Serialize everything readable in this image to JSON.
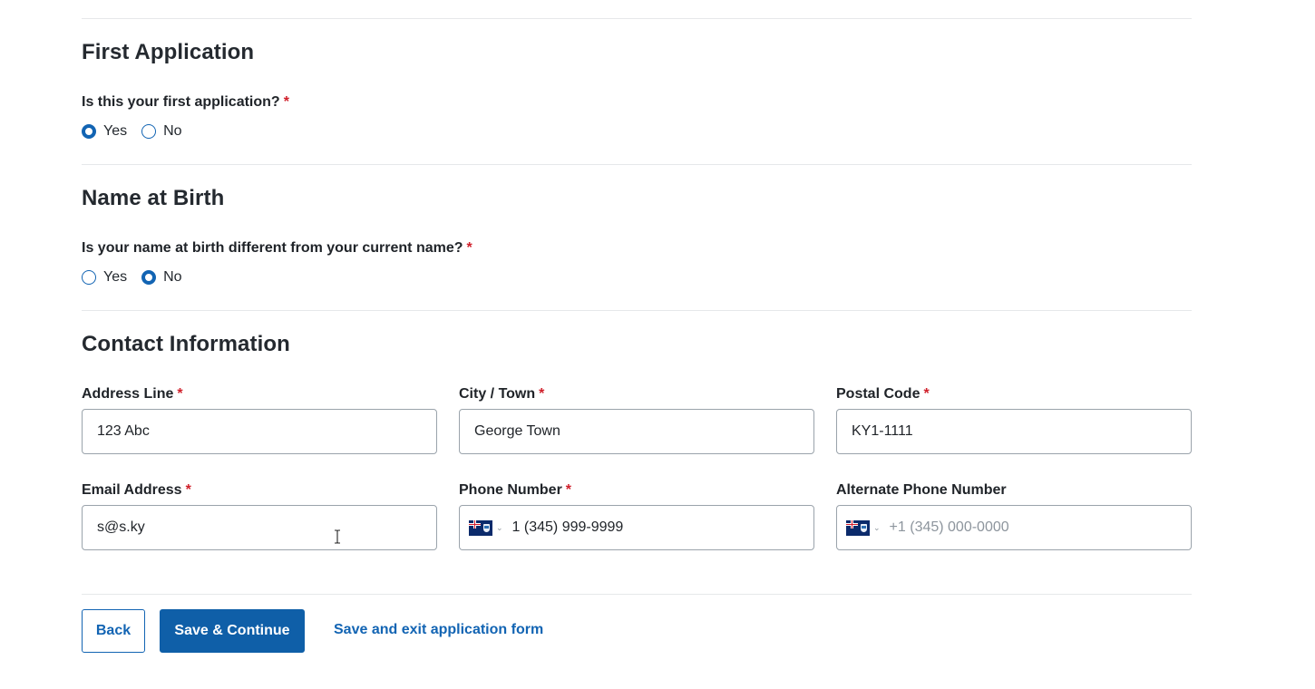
{
  "sections": {
    "first_application": {
      "title": "First Application",
      "question": "Is this your first application?",
      "required_mark": "*",
      "options": [
        {
          "label": "Yes",
          "checked": true
        },
        {
          "label": "No",
          "checked": false
        }
      ]
    },
    "name_at_birth": {
      "title": "Name at Birth",
      "question": "Is your name at birth different from your current name?",
      "required_mark": "*",
      "options": [
        {
          "label": "Yes",
          "checked": false
        },
        {
          "label": "No",
          "checked": true
        }
      ]
    },
    "contact": {
      "title": "Contact Information",
      "fields": {
        "address": {
          "label": "Address Line",
          "required_mark": "*",
          "value": "123 Abc"
        },
        "city": {
          "label": "City / Town",
          "required_mark": "*",
          "value": "George Town"
        },
        "postal": {
          "label": "Postal Code",
          "required_mark": "*",
          "value": "KY1-1111"
        },
        "email": {
          "label": "Email Address",
          "required_mark": "*",
          "value": "s@s.ky"
        },
        "phone": {
          "label": "Phone Number",
          "required_mark": "*",
          "value": "1 (345) 999-9999",
          "flag_icon": "cayman-islands-flag-icon"
        },
        "alt_phone": {
          "label": "Alternate Phone Number",
          "placeholder": "+1 (345) 000-0000",
          "flag_icon": "cayman-islands-flag-icon"
        }
      }
    }
  },
  "actions": {
    "back": "Back",
    "save_continue": "Save & Continue",
    "save_exit": "Save and exit application form"
  },
  "colors": {
    "primary": "#0f5fa8",
    "link": "#1264b3",
    "required": "#d0202b",
    "border": "#9aa3ab",
    "divider": "#e6e8ea"
  }
}
